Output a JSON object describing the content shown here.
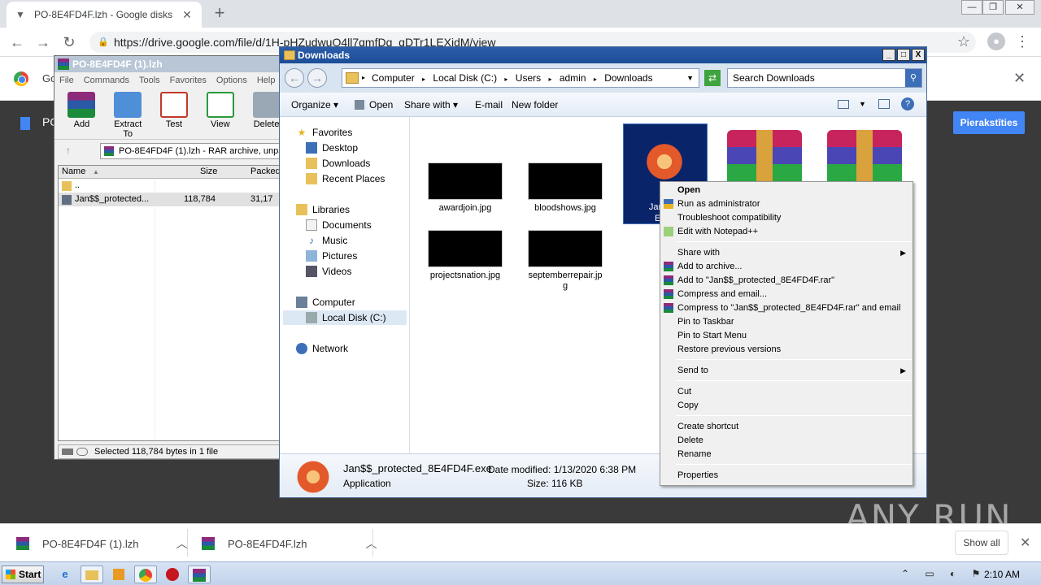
{
  "chrome": {
    "tab_title": "PO-8E4FD4F.lzh - Google disks",
    "url": "https://drive.google.com/file/d/1H-pHZudwuO4ll7qmfDq_qDTr1LEXidM/view",
    "minimize": "—",
    "restore": "❐",
    "close": "✕"
  },
  "drive": {
    "partial_label": "Go",
    "doc_title": "PO",
    "sign_in": "Pierakstīties"
  },
  "winrar": {
    "title": "PO-8E4FD4F (1).lzh",
    "menu": [
      "File",
      "Commands",
      "Tools",
      "Favorites",
      "Options",
      "Help"
    ],
    "toolbar": [
      "Add",
      "Extract To",
      "Test",
      "View",
      "Delete"
    ],
    "path": "PO-8E4FD4F (1).lzh - RAR archive, unpa",
    "columns": {
      "name": "Name",
      "size": "Size",
      "packed": "Packed"
    },
    "rows": [
      {
        "name": "..",
        "size": "",
        "packed": ""
      },
      {
        "name": "Jan$$_protected...",
        "size": "118,784",
        "packed": "31,17"
      }
    ],
    "status": "Selected 118,784 bytes in 1 file"
  },
  "explorer": {
    "title": "Downloads",
    "breadcrumb": [
      "Computer",
      "Local Disk (C:)",
      "Users",
      "admin",
      "Downloads"
    ],
    "search_placeholder": "Search Downloads",
    "commands": {
      "organize": "Organize",
      "open": "Open",
      "share": "Share with",
      "email": "E-mail",
      "newfolder": "New folder"
    },
    "nav": {
      "favorites": "Favorites",
      "desktop": "Desktop",
      "downloads": "Downloads",
      "recent": "Recent Places",
      "libraries": "Libraries",
      "documents": "Documents",
      "music": "Music",
      "pictures": "Pictures",
      "videos": "Videos",
      "computer": "Computer",
      "localdisk": "Local Disk (C:)",
      "network": "Network"
    },
    "files": {
      "f1": "awardjoin.jpg",
      "f2": "bloodshows.jpg",
      "f3": "projectsnation.jpg",
      "f4a": "septemberrepair.jp",
      "f4b": "g",
      "exe_lbl": "Jan$$_p",
      "exe_lbl2": "E4FD"
    },
    "details": {
      "filename": "Jan$$_protected_8E4FD4F.exe",
      "modified": "Date modified: 1/13/2020 6:38 PM",
      "type": "Application",
      "size": "Size: 116 KB"
    }
  },
  "context_menu": {
    "open": "Open",
    "runadmin": "Run as administrator",
    "troubleshoot": "Troubleshoot compatibility",
    "notepad": "Edit with Notepad++",
    "share": "Share with",
    "addarchive": "Add to archive...",
    "addrar": "Add to \"Jan$$_protected_8E4FD4F.rar\"",
    "compressemail": "Compress and email...",
    "compressrar": "Compress to \"Jan$$_protected_8E4FD4F.rar\" and email",
    "pintaskbar": "Pin to Taskbar",
    "pinstart": "Pin to Start Menu",
    "restore": "Restore previous versions",
    "sendto": "Send to",
    "cut": "Cut",
    "copy": "Copy",
    "shortcut": "Create shortcut",
    "delete": "Delete",
    "rename": "Rename",
    "properties": "Properties"
  },
  "downloads_bar": {
    "item1": "PO-8E4FD4F (1).lzh",
    "item2": "PO-8E4FD4F.lzh",
    "show_all": "Show all"
  },
  "taskbar": {
    "start": "Start",
    "clock": "2:10 AM"
  },
  "watermark": "ANY RUN"
}
